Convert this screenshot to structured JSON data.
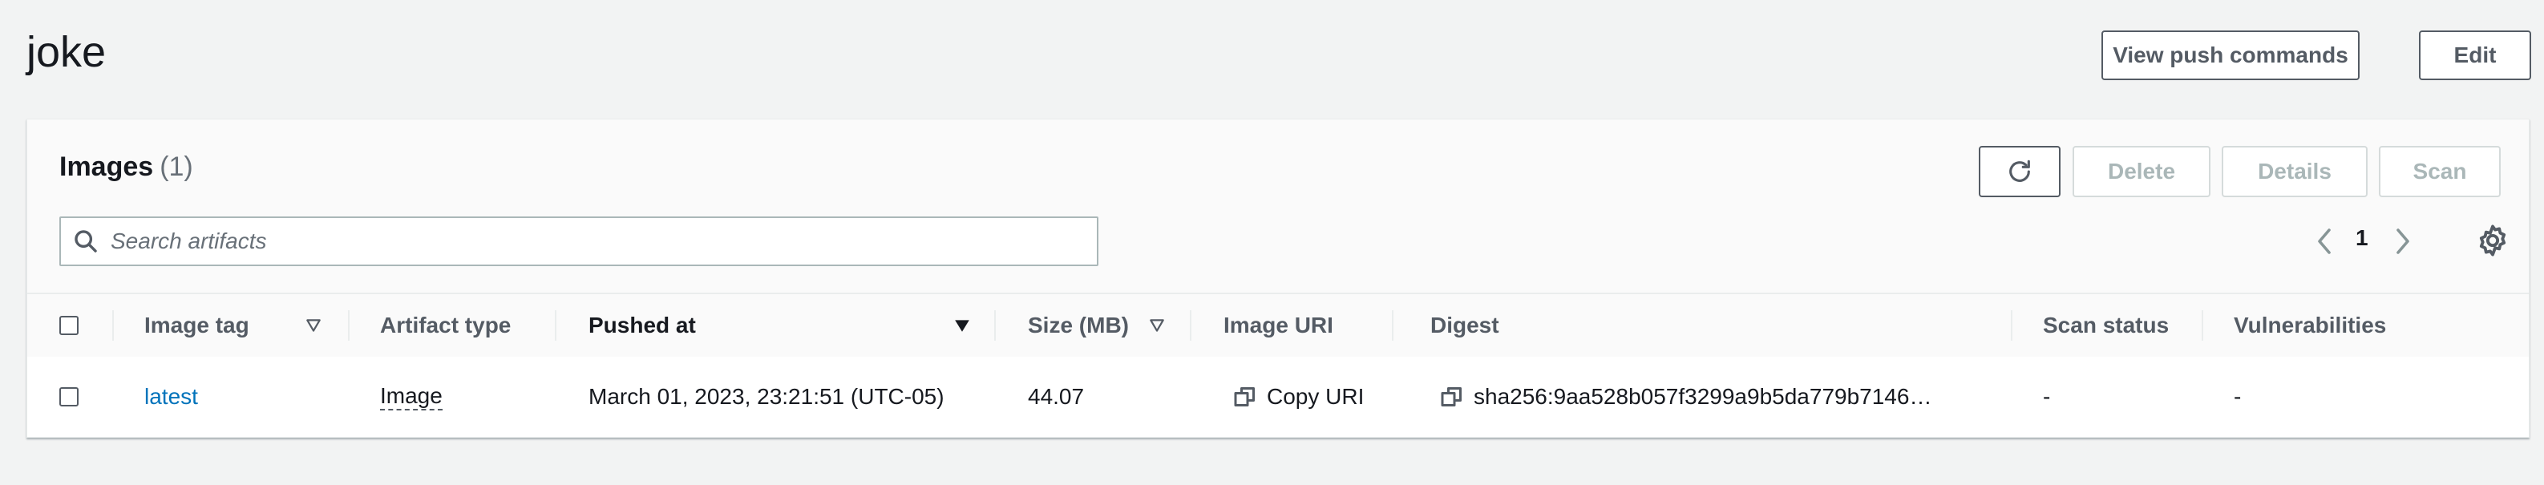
{
  "page": {
    "title": "joke",
    "view_push_commands_label": "View push commands",
    "edit_label": "Edit"
  },
  "images_panel": {
    "title": "Images",
    "count": "(1)",
    "delete_label": "Delete",
    "details_label": "Details",
    "scan_label": "Scan",
    "search": {
      "placeholder": "Search artifacts",
      "value": ""
    },
    "pagination": {
      "current_page": "1"
    }
  },
  "table": {
    "columns": [
      "Image tag",
      "Artifact type",
      "Pushed at",
      "Size (MB)",
      "Image URI",
      "Digest",
      "Scan status",
      "Vulnerabilities"
    ],
    "sorted_column": "Pushed at",
    "rows": [
      {
        "image_tag": "latest",
        "artifact_type": "Image",
        "pushed_at": "March 01, 2023, 23:21:51 (UTC-05)",
        "size_mb": "44.07",
        "image_uri": "Copy URI",
        "digest": "sha256:9aa528b057f3299a9b5da779b7146…",
        "scan_status": "-",
        "vulnerabilities": "-"
      }
    ]
  },
  "icons": [
    "refresh-icon",
    "search-icon",
    "chevron-left-icon",
    "chevron-right-icon",
    "gear-icon",
    "sort-filter-icon",
    "sort-desc-icon",
    "copy-icon"
  ],
  "colors": {
    "link": "#0073bb",
    "text": "#16191f",
    "muted": "#687078",
    "background": "#f2f3f3"
  }
}
